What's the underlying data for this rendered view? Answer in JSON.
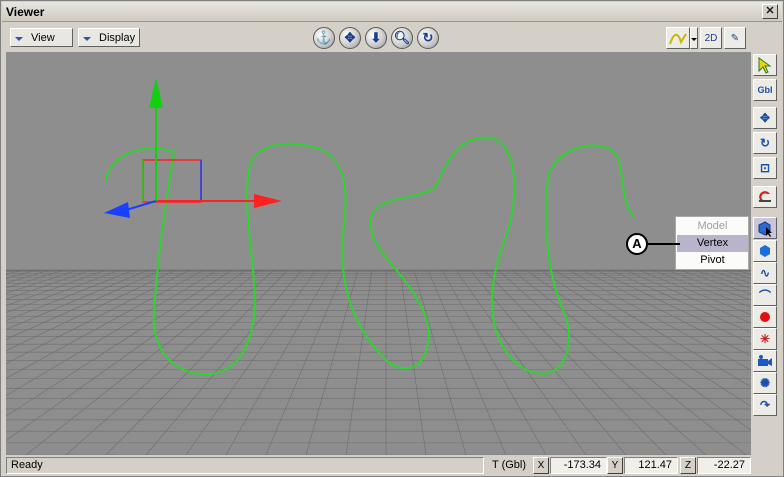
{
  "window": {
    "title": "Viewer",
    "close_glyph": "✕"
  },
  "toolbar": {
    "view_label": "View",
    "display_label": "Display",
    "nav_icons": [
      "pan-icon",
      "move-icon",
      "dolly-icon",
      "zoom-icon",
      "orbit-icon"
    ],
    "twod_label": "2D"
  },
  "right_panel": {
    "gbl_label": "Gbl"
  },
  "context_menu": {
    "items": [
      {
        "label": "Model",
        "state": "disabled"
      },
      {
        "label": "Vertex",
        "state": "highlighted"
      },
      {
        "label": "Pivot",
        "state": "normal"
      }
    ]
  },
  "callout": {
    "label": "A"
  },
  "status": {
    "text": "Ready",
    "coord_mode": "T (Gbl)",
    "x_label": "X",
    "x_value": "-173.34",
    "y_label": "Y",
    "y_value": "121.47",
    "z_label": "Z",
    "z_value": "-22.27"
  },
  "colors": {
    "curve": "#2fd42f",
    "axis_x": "#ff2020",
    "axis_y": "#10d010",
    "axis_z": "#1a40ff",
    "viewport_bg": "#8e8e8e",
    "grid": "#6e6e6e"
  }
}
